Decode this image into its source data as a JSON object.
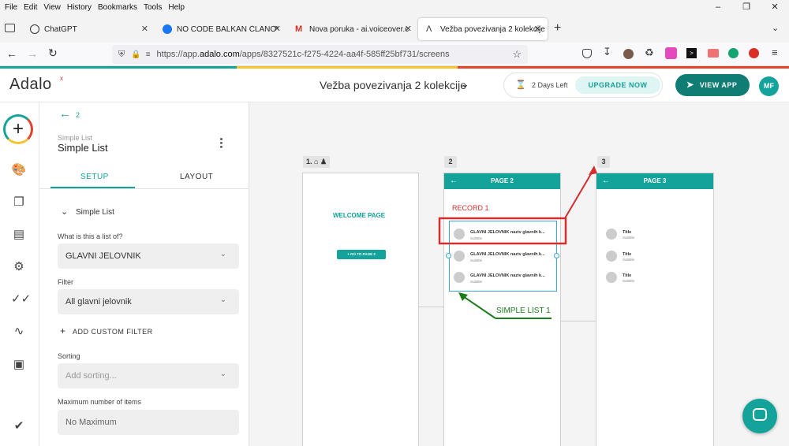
{
  "menubar": {
    "items": [
      "File",
      "Edit",
      "View",
      "History",
      "Bookmarks",
      "Tools",
      "Help"
    ]
  },
  "tabs": [
    {
      "label": "ChatGPT"
    },
    {
      "label": "NO CODE BALKAN ČLANOVI | F"
    },
    {
      "label": "Nova poruka - ai.voiceover.cre"
    },
    {
      "label": "Vežba povezivanja 2 kolekcije"
    }
  ],
  "navbar": {
    "url_host_prefix": "https://app.",
    "url_host": "adalo.com",
    "url_path": "/apps/8327521c-f275-4224-aa4f-585ff25bf731/screens"
  },
  "app": {
    "logo": "Adalo",
    "project_title": "Vežba povezivanja 2 kolekcije",
    "trial_label": "2 Days Left",
    "upgrade_label": "UPGRADE NOW",
    "view_app_label": "VIEW APP",
    "avatar_initials": "MF"
  },
  "colors": {
    "brand_teal": "#14a39a",
    "accent_red": "#d32f2f",
    "accent_green": "#1b7d1b"
  },
  "panel": {
    "back_label": "2",
    "component_type": "Simple List",
    "component_name": "Simple List",
    "tabs": [
      "SETUP",
      "LAYOUT"
    ],
    "section_label": "Simple List",
    "list_of_label": "What is this a list of?",
    "list_of_value": "GLAVNI JELOVNIK",
    "filter_label": "Filter",
    "filter_value": "All glavni jelovnik",
    "add_filter_label": "ADD CUSTOM FILTER",
    "sorting_label": "Sorting",
    "sorting_placeholder": "Add sorting...",
    "max_label": "Maximum number of items",
    "max_value": "No Maximum"
  },
  "canvas": {
    "screen1": {
      "label": "1.",
      "welcome": "WELCOME PAGE",
      "button": "GO TO PAGE 2"
    },
    "screen2": {
      "label": "2",
      "header": "PAGE 2",
      "rows": [
        {
          "title": "GLAVNI JELOVNIK naziv glavnih k...",
          "subtitle": "Subtitle"
        },
        {
          "title": "GLAVNI JELOVNIK naziv glavnih k...",
          "subtitle": "Subtitle"
        },
        {
          "title": "GLAVNI JELOVNIK naziv glavnih k...",
          "subtitle": "Subtitle"
        }
      ]
    },
    "screen3": {
      "label": "3",
      "header": "PAGE 3",
      "rows": [
        {
          "title": "Title",
          "subtitle": "Subtitle"
        },
        {
          "title": "Title",
          "subtitle": "Subtitle"
        },
        {
          "title": "Title",
          "subtitle": "Subtitle"
        }
      ]
    },
    "annotations": {
      "record": "RECORD 1",
      "list": "SIMPLE LIST 1"
    }
  }
}
